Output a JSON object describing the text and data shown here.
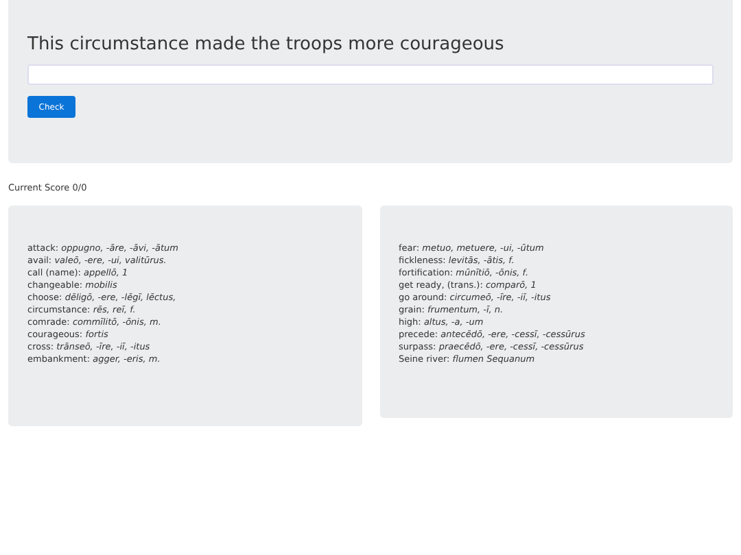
{
  "question": {
    "prompt": "This circumstance made the troops more courageous",
    "check_button": "Check"
  },
  "score": "Current Score 0/0",
  "vocab_columns": [
    [
      {
        "term": "attack:",
        "latin": "oppugno, -āre, -āvi, -ātum"
      },
      {
        "term": "avail:",
        "latin": "valeō, -ere, -ui, valitūrus."
      },
      {
        "term": "call (name):",
        "latin": "appellō, 1"
      },
      {
        "term": "changeable:",
        "latin": "mobilis"
      },
      {
        "term": "choose:",
        "latin": "dēligō, -ere, -lēgī, lēctus,"
      },
      {
        "term": "circumstance:",
        "latin": "rēs, reī, f."
      },
      {
        "term": "comrade:",
        "latin": "commīlitō, -ōnis, m."
      },
      {
        "term": "courageous:",
        "latin": "fortis"
      },
      {
        "term": "cross:",
        "latin": "trānseō, -īre, -iī, -itus"
      },
      {
        "term": "embankment:",
        "latin": "agger, -eris, m."
      }
    ],
    [
      {
        "term": "fear:",
        "latin": "metuo, metuere, -ui, -ūtum"
      },
      {
        "term": "fickleness:",
        "latin": "levitās, -ātis, f."
      },
      {
        "term": "fortification:",
        "latin": "mūnītiō, -ōnis, f."
      },
      {
        "term": "get ready, (trans.):",
        "latin": "comparō, 1"
      },
      {
        "term": "go around:",
        "latin": "circumeō, -īre, -iī, -itus"
      },
      {
        "term": "grain:",
        "latin": "frumentum, -ī, n."
      },
      {
        "term": "high:",
        "latin": "altus, -a, -um"
      },
      {
        "term": "precede:",
        "latin": "antecēdō, -ere, -cessī, -cessūrus"
      },
      {
        "term": "surpass:",
        "latin": "praecēdō, -ere, -cessī, -cessūrus"
      },
      {
        "term": "Seine river:",
        "latin": "flumen Sequanum"
      }
    ]
  ]
}
